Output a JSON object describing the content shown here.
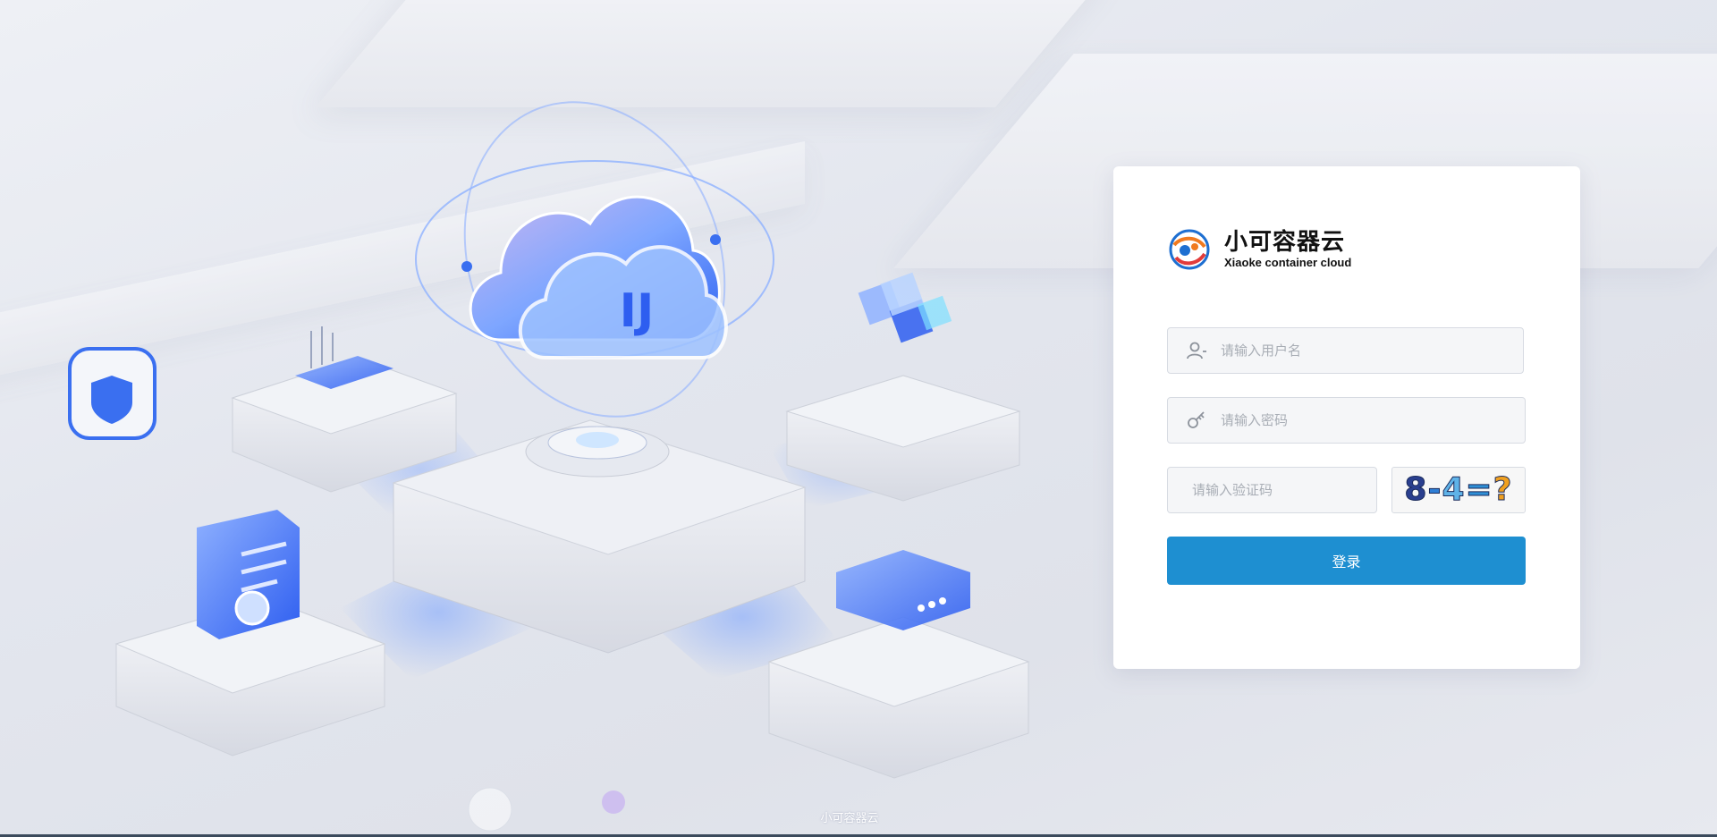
{
  "brand": {
    "name_cn": "小可容器云",
    "name_en": "Xiaoke container cloud",
    "logo_icon": "globe-swirl-logo"
  },
  "login": {
    "username_placeholder": "请输入用户名",
    "password_placeholder": "请输入密码",
    "captcha_placeholder": "请输入验证码",
    "captcha_chars": [
      "8",
      "-",
      "4",
      "=",
      "?"
    ],
    "captcha_colors": [
      "#2a3f8f",
      "#2f7fd6",
      "#5fb3e8",
      "#2f8fd6",
      "#f0a020"
    ],
    "submit_label": "登录",
    "user_icon": "user-icon",
    "password_icon": "key-icon"
  },
  "footer": {
    "text": "小可容器云"
  },
  "colors": {
    "primary": "#1e8fd1",
    "card_bg": "#ffffff",
    "input_bg": "#f5f6f8",
    "accent_blue": "#3a6ff0"
  }
}
